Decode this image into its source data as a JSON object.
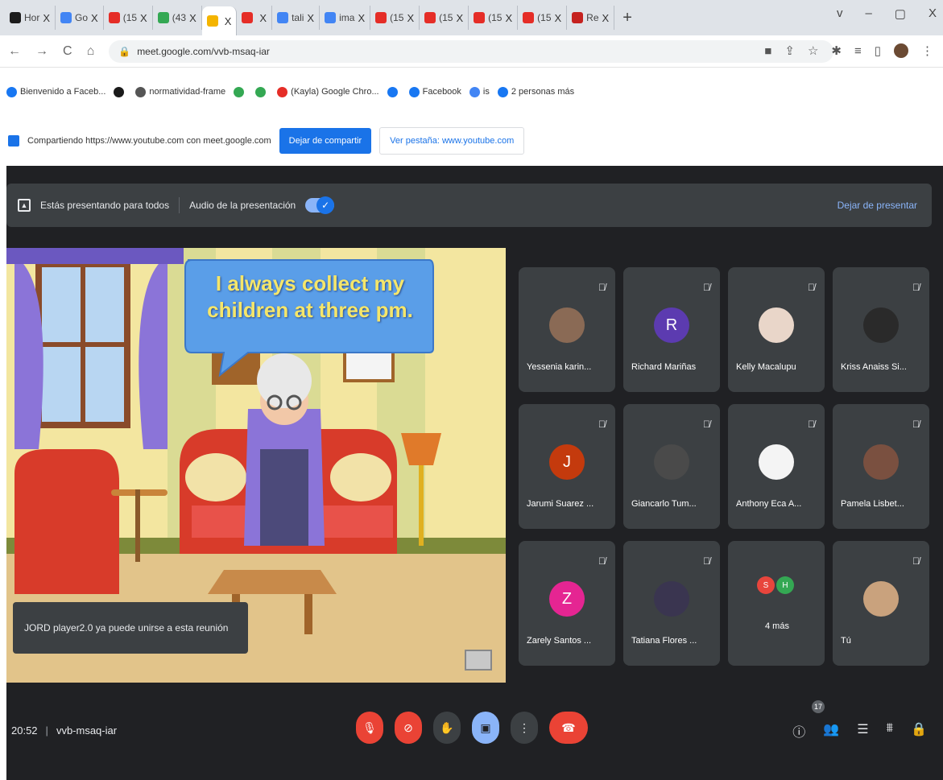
{
  "browser": {
    "tabs": [
      {
        "label": "Hor",
        "color": "#1c1c1c"
      },
      {
        "label": "Go",
        "color": "#4285f4"
      },
      {
        "label": "(15",
        "color": "#e52d27"
      },
      {
        "label": "(43",
        "color": "#34a853"
      },
      {
        "label": "",
        "color": "#f4b400"
      },
      {
        "label": "",
        "color": "#e52d27"
      },
      {
        "label": "tali",
        "color": "#4285f4"
      },
      {
        "label": "ima",
        "color": "#4285f4"
      },
      {
        "label": "(15",
        "color": "#e52d27"
      },
      {
        "label": "(15",
        "color": "#e52d27"
      },
      {
        "label": "(15",
        "color": "#e52d27"
      },
      {
        "label": "(15",
        "color": "#e52d27"
      },
      {
        "label": "Re",
        "color": "#c5221f"
      }
    ],
    "close_glyph": "X",
    "new_tab": "+",
    "window_controls": [
      "v",
      "–",
      "▢",
      "X"
    ],
    "nav": {
      "back": "←",
      "forward": "→",
      "reload": "C",
      "home": "⌂"
    },
    "url": "meet.google.com/vvb-msaq-iar",
    "bookmarks": [
      {
        "label": "Bienvenido a Faceb...",
        "color": "#1877f2"
      },
      {
        "label": "",
        "color": "#1a1a1a"
      },
      {
        "label": "normatividad-frame",
        "color": "#555555"
      },
      {
        "label": "",
        "color": "#34a853"
      },
      {
        "label": "",
        "color": "#34a853"
      },
      {
        "label": "(Kayla) Google Chro...",
        "color": "#e52d27"
      },
      {
        "label": "",
        "color": "#1877f2"
      },
      {
        "label": "Facebook",
        "color": "#1877f2"
      },
      {
        "label": "is",
        "color": "#4285f4"
      },
      {
        "label": "2 personas más",
        "color": "#1877f2"
      }
    ]
  },
  "share": {
    "text": "Compartiendo https://www.youtube.com con meet.google.com",
    "stop_label": "Dejar de compartir",
    "view_label": "Ver pestaña: www.youtube.com"
  },
  "meet": {
    "presenting_label": "Estás presentando para todos",
    "audio_label": "Audio de la presentación",
    "stop_presenting": "Dejar de presentar",
    "slide_caption": "I always collect my children at three pm.",
    "toast": "JORD player2.0 ya puede unirse a esta reunión",
    "time": "20:52",
    "separator": "|",
    "meeting_code": "vvb-msaq-iar",
    "participant_count": "17",
    "participants": [
      {
        "name": "Yessenia karin...",
        "initial": "",
        "color": "#8a6a55"
      },
      {
        "name": "Richard Mariñas",
        "initial": "R",
        "color": "#5c3bb0"
      },
      {
        "name": "Kelly Macalupu",
        "initial": "",
        "color": "#e9d6c9"
      },
      {
        "name": "Kriss Anaiss Si...",
        "initial": "",
        "color": "#2a2a2a"
      },
      {
        "name": "Jarumi Suarez ...",
        "initial": "J",
        "color": "#c43a0d"
      },
      {
        "name": "Giancarlo Tum...",
        "initial": "",
        "color": "#4a4a4a"
      },
      {
        "name": "Anthony Eca A...",
        "initial": "",
        "color": "#f4f4f4"
      },
      {
        "name": "Pamela Lisbet...",
        "initial": "",
        "color": "#7a5040"
      },
      {
        "name": "Zarely Santos ...",
        "initial": "Z",
        "color": "#e52592"
      },
      {
        "name": "Tatiana Flores ...",
        "initial": "",
        "color": "#3a3550"
      },
      {
        "name": "4 más",
        "initial": "",
        "color": "#3c4043"
      },
      {
        "name": "Tú",
        "initial": "",
        "color": "#c9a27d"
      }
    ],
    "more_avatars": [
      {
        "initial": "S",
        "color": "#e8453c"
      },
      {
        "initial": "H",
        "color": "#34a853"
      }
    ]
  }
}
